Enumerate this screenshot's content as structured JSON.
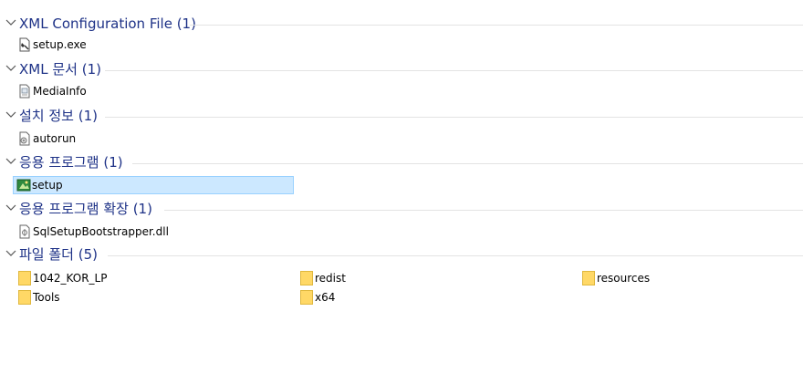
{
  "groups": [
    {
      "title": "XML Configuration File (1)",
      "items": [
        "setup.exe"
      ]
    },
    {
      "title": "XML 문서 (1)",
      "items": [
        "MediaInfo"
      ]
    },
    {
      "title": "설치 정보 (1)",
      "items": [
        "autorun"
      ]
    },
    {
      "title": "응용 프로그램 (1)",
      "items": [
        "setup"
      ]
    },
    {
      "title": "응용 프로그램 확장 (1)",
      "items": [
        "SqlSetupBootstrapper.dll"
      ]
    },
    {
      "title": "파일 폴더 (5)",
      "items": [
        "1042_KOR_LP",
        "redist",
        "resources",
        "Tools",
        "x64"
      ]
    }
  ],
  "selected_item": "setup",
  "colors": {
    "group_title": "#1e3287",
    "selection_bg": "#cce8ff",
    "selection_border": "#99d1ff",
    "folder": "#ffd866"
  },
  "icons": {
    "setup_exe": "config-file-icon",
    "mediainfo": "xml-document-icon",
    "autorun": "setup-information-icon",
    "setup": "application-icon",
    "dll": "dll-file-icon",
    "folder": "folder-icon",
    "chevron": "chevron-down-icon"
  }
}
